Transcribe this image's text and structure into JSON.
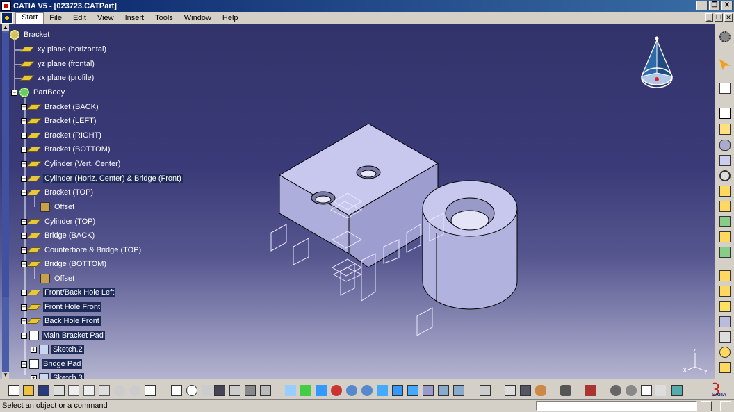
{
  "window": {
    "title": "CATIA V5 - [023723.CATPart]",
    "minimize": "_",
    "restore": "❐",
    "close": "✕"
  },
  "menu": [
    "Start",
    "File",
    "Edit",
    "View",
    "Insert",
    "Tools",
    "Window",
    "Help"
  ],
  "tree": {
    "root": "Bracket",
    "planes": [
      "xy plane (horizontal)",
      "yz plane (frontal)",
      "zx plane (profile)"
    ],
    "body": "PartBody",
    "items": [
      {
        "label": "Bracket (BACK)",
        "type": "plane"
      },
      {
        "label": "Bracket (LEFT)",
        "type": "plane"
      },
      {
        "label": "Bracket (RIGHT)",
        "type": "plane"
      },
      {
        "label": "Bracket (BOTTOM)",
        "type": "plane"
      },
      {
        "label": "Cylinder (Vert. Center)",
        "type": "plane"
      },
      {
        "label": "Cylinder (Horiz. Center) & Bridge (Front)",
        "type": "plane"
      },
      {
        "label": "Bracket (TOP)",
        "type": "plane"
      },
      {
        "label": "Offset",
        "type": "feature",
        "child": true
      },
      {
        "label": "Cylinder (TOP)",
        "type": "plane"
      },
      {
        "label": "Bridge (BACK)",
        "type": "plane"
      },
      {
        "label": "Counterbore & Bridge (TOP)",
        "type": "plane"
      },
      {
        "label": "Bridge (BOTTOM)",
        "type": "plane"
      },
      {
        "label": "Offset",
        "type": "feature",
        "child": true
      },
      {
        "label": "Front/Back Hole Left",
        "type": "plane"
      },
      {
        "label": "Front Hole Front",
        "type": "plane"
      },
      {
        "label": "Back Hole Front",
        "type": "plane"
      },
      {
        "label": "Main Bracket Pad",
        "type": "pad"
      },
      {
        "label": "Sketch.2",
        "type": "sketch",
        "child": true
      },
      {
        "label": "Bridge Pad",
        "type": "pad"
      },
      {
        "label": "Sketch.3",
        "type": "sketch",
        "child": true
      }
    ]
  },
  "status": {
    "message": "Select an object or a command",
    "command_value": ""
  },
  "axis_labels": {
    "x": "x",
    "y": "y",
    "z": "z"
  },
  "logo_text": "CATIA",
  "colors": {
    "viewport_top": "#33336b",
    "viewport_bottom": "#b4b4cf",
    "part_face": "#c8c8ee",
    "tree_text": "#ffffff"
  }
}
